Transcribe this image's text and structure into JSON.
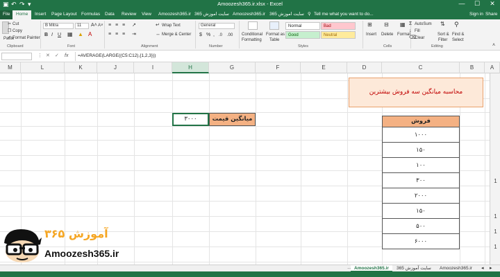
{
  "window": {
    "title": "Amoozesh365.ir.xlsx - Excel",
    "quick_access": [
      "↶",
      "↷",
      "▾"
    ],
    "controls": [
      "—",
      "☐",
      "✕"
    ]
  },
  "tabs": {
    "file": "File",
    "items": [
      "Home",
      "Insert",
      "Page Layout",
      "Formulas",
      "Data",
      "Review",
      "View",
      "Amoozesh365.ir",
      "سایت اموزش 365",
      "Amoozesh365.ir",
      "سایت اموزش 365"
    ],
    "tell_me": "Tell me what you want to do...",
    "sign_in": "Sign in",
    "share": "Share"
  },
  "ribbon": {
    "clipboard": {
      "paste": "Paste",
      "cut": "Cut",
      "copy": "Copy",
      "format_painter": "Format Painter",
      "label": "Clipboard"
    },
    "font": {
      "name": "B Mitra",
      "size": "11",
      "label": "Font"
    },
    "alignment": {
      "wrap": "Wrap Text",
      "merge": "Merge & Center",
      "label": "Alignment"
    },
    "number": {
      "format": "General",
      "label": "Number"
    },
    "styles": {
      "conditional": "Conditional",
      "formatting": "Formatting",
      "format_as": "Format as",
      "table": "Table",
      "normal": "Normal",
      "bad": "Bad",
      "good": "Good",
      "neutral": "Neutral",
      "label": "Styles"
    },
    "cells": {
      "insert": "Insert",
      "delete": "Delete",
      "format": "Format",
      "label": "Cells"
    },
    "editing": {
      "autosum": "AutoSum",
      "fill": "Fill",
      "clear": "Clear",
      "sort_filter": "Sort &",
      "filter": "Filter",
      "find": "Find &",
      "select": "Select",
      "label": "Editing"
    }
  },
  "formula_bar": {
    "fx": "fx",
    "formula": "=AVERAGE(LARGE((C5:C12),{1,2,3}))"
  },
  "columns": [
    "M",
    "L",
    "K",
    "J",
    "I",
    "H",
    "G",
    "F",
    "E",
    "D",
    "C",
    "B",
    "A"
  ],
  "selected_column": "H",
  "row_numbers": [
    "1",
    "1",
    "1",
    "1"
  ],
  "callout": "محاسبه میانگین سه فروش بیشترین",
  "sales": {
    "header": "فروش",
    "values": [
      "۱۰۰۰",
      "۱۵۰",
      "۱۰۰",
      "۳۰۰",
      "۲۰۰۰",
      "۱۵۰",
      "۵۰۰",
      "۶۰۰۰"
    ]
  },
  "average": {
    "label": "میانگین قیمت",
    "value": "۳۰۰۰"
  },
  "logo": {
    "fa": "آموزش ۳۶۵",
    "en": "Amoozesh365.ir"
  },
  "sheets": [
    "Amoozesh365.ir",
    "سایت آموزش 365",
    "Amoozesh365.ir"
  ],
  "colors": {
    "excel_green": "#217346",
    "header_orange": "#f4b183",
    "callout_bg": "#fde9d9",
    "callout_text": "#c00000"
  }
}
